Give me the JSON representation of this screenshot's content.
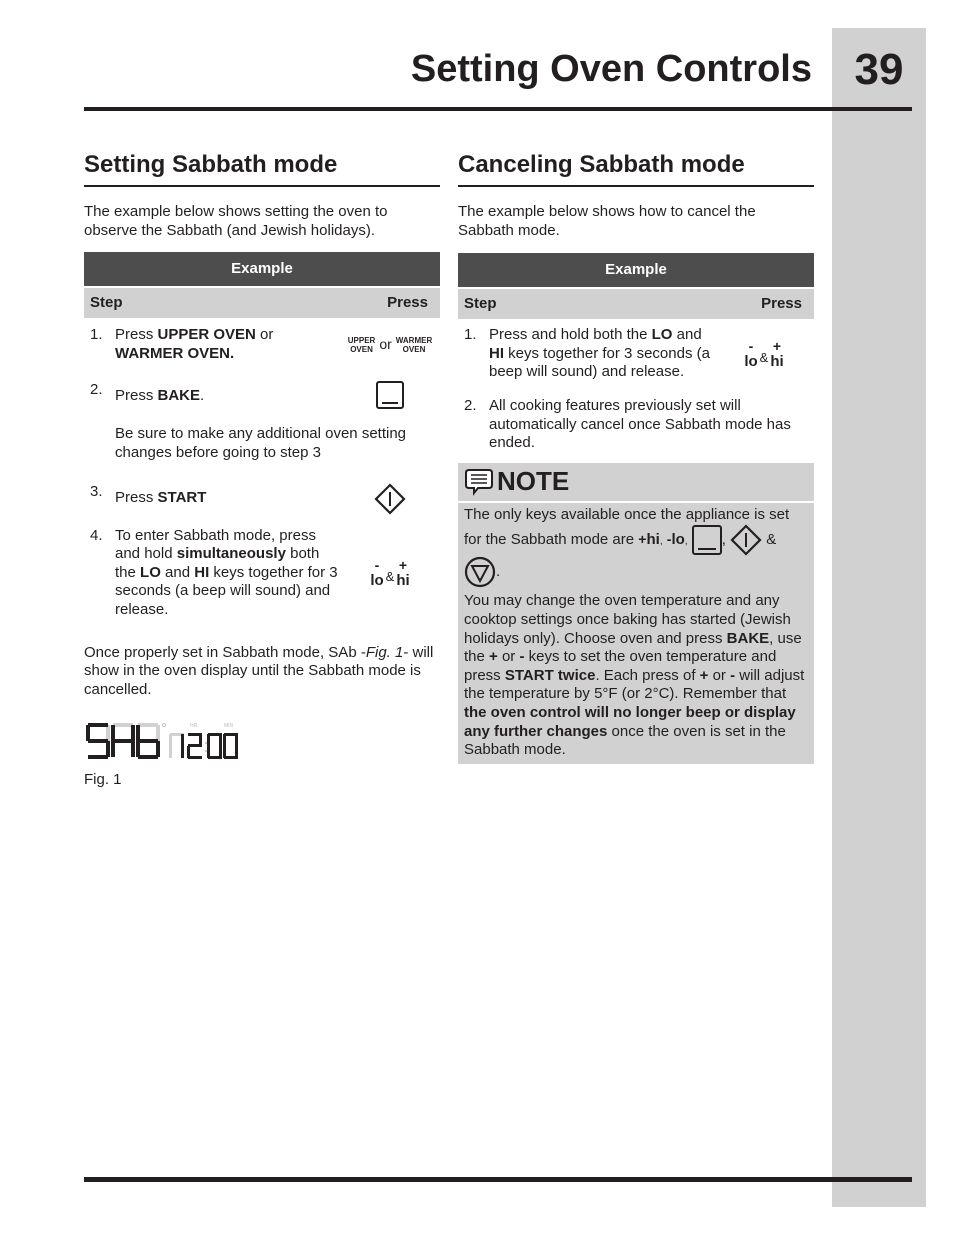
{
  "header": {
    "title": "Setting Oven Controls",
    "page_number": "39"
  },
  "left": {
    "heading": "Setting Sabbath mode",
    "intro": "The example below shows setting the oven to observe the Sabbath (and Jewish holidays).",
    "table": {
      "title": "Example",
      "col_step": "Step",
      "col_press": "Press",
      "steps": [
        {
          "num": "1.",
          "t1": "Press ",
          "b1": "UPPER OVEN",
          "t2": " or ",
          "b2": "WARMER OVEN.",
          "key": "upper-or-warmer"
        },
        {
          "num": "2.",
          "t1": "Press ",
          "b1": "BAKE",
          "t2": ".",
          "key": "bake"
        },
        {
          "num": "3.",
          "t1": "Press ",
          "b1": "START",
          "key": "start"
        },
        {
          "num": "4.",
          "t1": "To enter Sabbath mode, press and hold ",
          "b1": "simultaneously",
          "t2": " both the ",
          "b2": "LO",
          "t3": " and ",
          "b3": "HI",
          "t4": " keys together for 3 seconds (a beep will sound) and release.",
          "key": "lo-hi"
        }
      ],
      "between_note": "Be sure to make any additional oven setting changes before going to step 3"
    },
    "after_text_1": "Once properly set in Sabbath mode, SAb -",
    "after_text_fig": "Fig. 1",
    "after_text_2": "- will show in the oven display until the Sabbath mode is cancelled.",
    "display": {
      "left": "SAb",
      "right": "12:00",
      "hr_label": "HR",
      "min_label": "MIN"
    },
    "fig_caption": "Fig. 1"
  },
  "right": {
    "heading": "Canceling Sabbath mode",
    "intro": "The example below shows how to cancel the Sabbath mode.",
    "table": {
      "title": "Example",
      "col_step": "Step",
      "col_press": "Press",
      "steps": [
        {
          "num": "1.",
          "t1": "Press and hold both the ",
          "b1": "LO",
          "t2": " and ",
          "b2": "HI",
          "t3": " keys together for 3 seconds (a beep will sound) and release.",
          "key": "lo-hi"
        },
        {
          "num": "2.",
          "t1": "All cooking features previously set will automatically cancel once Sabbath mode has ended."
        }
      ]
    },
    "note": {
      "title": "NOTE",
      "p1": "The only keys available once the appliance is set for the Sabbath mode are",
      "p2_1": "You may change the oven temperature and any cooktop settings once baking has started (Jewish holidays only). Choose oven and press ",
      "p2_b1": "BAKE",
      "p2_2": ", use the ",
      "p2_b2": "+",
      "p2_3": " or ",
      "p2_b3": "-",
      "p2_4": " keys to set the oven temperature and press ",
      "p2_b4": "START twice",
      "p2_5": ". Each press of ",
      "p2_b5": "+",
      "p2_6": " or ",
      "p2_b6": "-",
      "p2_7": " will adjust the temperature by 5°F (or 2°C). Remember that ",
      "p2_b7": "the oven control will no longer beep or display any further changes",
      "p2_8": " once the oven is set in the Sabbath mode."
    }
  },
  "keys": {
    "upper_top": "UPPER",
    "upper_bottom": "OVEN",
    "or": "or",
    "warmer_top": "WARMER",
    "warmer_bottom": "OVEN",
    "lo": "lo",
    "hi": "hi",
    "minus": "-",
    "plus": "+",
    "amp": "&",
    "comma": ",",
    "period": "."
  }
}
